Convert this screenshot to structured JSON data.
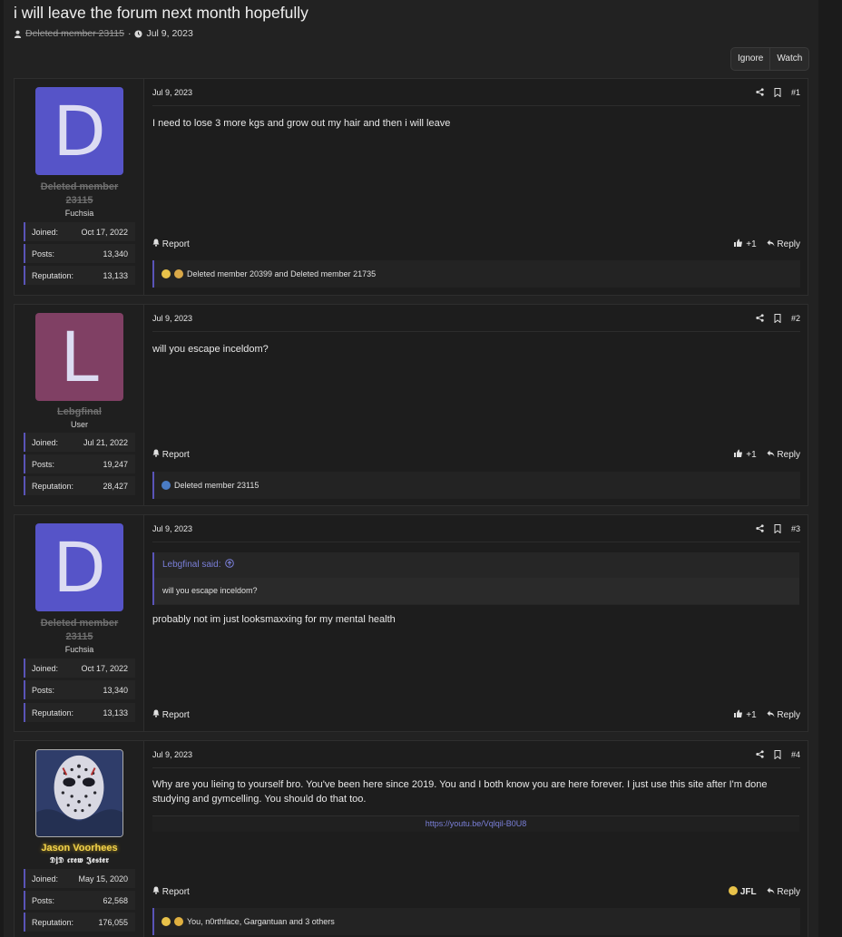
{
  "thread": {
    "title": "i will leave the forum next month hopefully",
    "author": "Deleted member 23115",
    "separator": "·",
    "date": "Jul 9, 2023"
  },
  "actions": {
    "ignore_label": "Ignore",
    "watch_label": "Watch"
  },
  "labels": {
    "report": "Report",
    "reply": "Reply",
    "plus_one": "+1",
    "joined": "Joined:",
    "posts": "Posts:",
    "reputation": "Reputation:"
  },
  "posts": [
    {
      "number": "#1",
      "date": "Jul 9, 2023",
      "avatar_letter": "D",
      "avatar_color": "#5654c8",
      "username": "Deleted member 23115",
      "user_title": "Fuchsia",
      "joined": "Oct 17, 2022",
      "posts": "13,340",
      "reputation": "13,133",
      "body": "I need to lose 3 more kgs and grow out my hair and then i will leave",
      "reactions_text": "Deleted member 20399 and Deleted member 21735"
    },
    {
      "number": "#2",
      "date": "Jul 9, 2023",
      "avatar_letter": "L",
      "avatar_color": "#804064",
      "username": "Lebgfinal",
      "user_title": "User",
      "joined": "Jul 21, 2022",
      "posts": "19,247",
      "reputation": "28,427",
      "body": "will you escape inceldom?",
      "reactions_text": "Deleted member 23115"
    },
    {
      "number": "#3",
      "date": "Jul 9, 2023",
      "avatar_letter": "D",
      "avatar_color": "#5654c8",
      "username": "Deleted member 23115",
      "user_title": "Fuchsia",
      "joined": "Oct 17, 2022",
      "posts": "13,340",
      "reputation": "13,133",
      "quote_author": "Lebgfinal said:",
      "quote_text": "will you escape inceldom?",
      "body": "probably not im just looksmaxxing for my mental health"
    },
    {
      "number": "#4",
      "date": "Jul 9, 2023",
      "username": "Jason Voorhees",
      "user_title": "𝕯𝖏𝕯 𝖈𝖗𝖊𝖜 𝕵𝖊𝖘𝖙𝖊𝖗",
      "joined": "May 15, 2020",
      "posts": "62,568",
      "reputation": "176,055",
      "body": "Why are you lieing to yourself bro. You've been here since 2019. You and I both know you are here forever. I just use this site after I'm done studying and gymcelling. You should do that too.",
      "link": "https://youtu.be/Vqlqil-B0U8",
      "reaction_label": "JFL",
      "reactions_text": "You, n0rthface, Gargantuan and 3 others"
    }
  ],
  "icons": [
    "user-icon",
    "clock-icon",
    "share-icon",
    "bookmark-icon",
    "bell-icon",
    "thumbs-up-icon",
    "reply-icon",
    "arrow-up-circle-icon"
  ]
}
